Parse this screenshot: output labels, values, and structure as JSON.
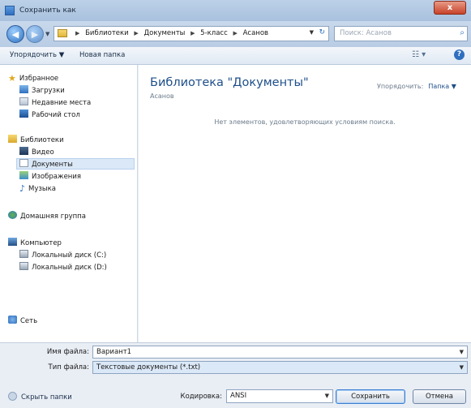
{
  "window": {
    "title": "Сохранить как",
    "close_label": "x"
  },
  "navigation": {
    "breadcrumbs": [
      "Библиотеки",
      "Документы",
      "5-класс",
      "Асанов"
    ],
    "search_placeholder": "Поиск: Асанов"
  },
  "toolbar": {
    "organize_label": "Упорядочить ▼",
    "new_folder_label": "Новая папка"
  },
  "sidebar": {
    "favorites": {
      "label": "Избранное",
      "items": [
        "Загрузки",
        "Недавние места",
        "Рабочий стол"
      ]
    },
    "libraries": {
      "label": "Библиотеки",
      "items": [
        "Видео",
        "Документы",
        "Изображения",
        "Музыка"
      ],
      "selected": "Документы"
    },
    "homegroup": "Домашняя группа",
    "computer": {
      "label": "Компьютер",
      "items": [
        "Локальный диск (C:)",
        "Локальный диск (D:)"
      ]
    },
    "network": "Сеть"
  },
  "content": {
    "library_title": "Библиотека \"Документы\"",
    "library_subtitle": "Асанов",
    "arrange_label": "Упорядочить:",
    "arrange_value": "Папка ▼",
    "empty_message": "Нет элементов, удовлетворяющих условиям поиска."
  },
  "form": {
    "filename_label": "Имя файла:",
    "filename_value": "Вариант1",
    "filetype_label": "Тип файла:",
    "filetype_value": "Текстовые документы (*.txt)",
    "encoding_label": "Кодировка:",
    "encoding_value": "ANSI",
    "hide_folders_label": "Скрыть папки",
    "save_label": "Сохранить",
    "cancel_label": "Отмена"
  }
}
